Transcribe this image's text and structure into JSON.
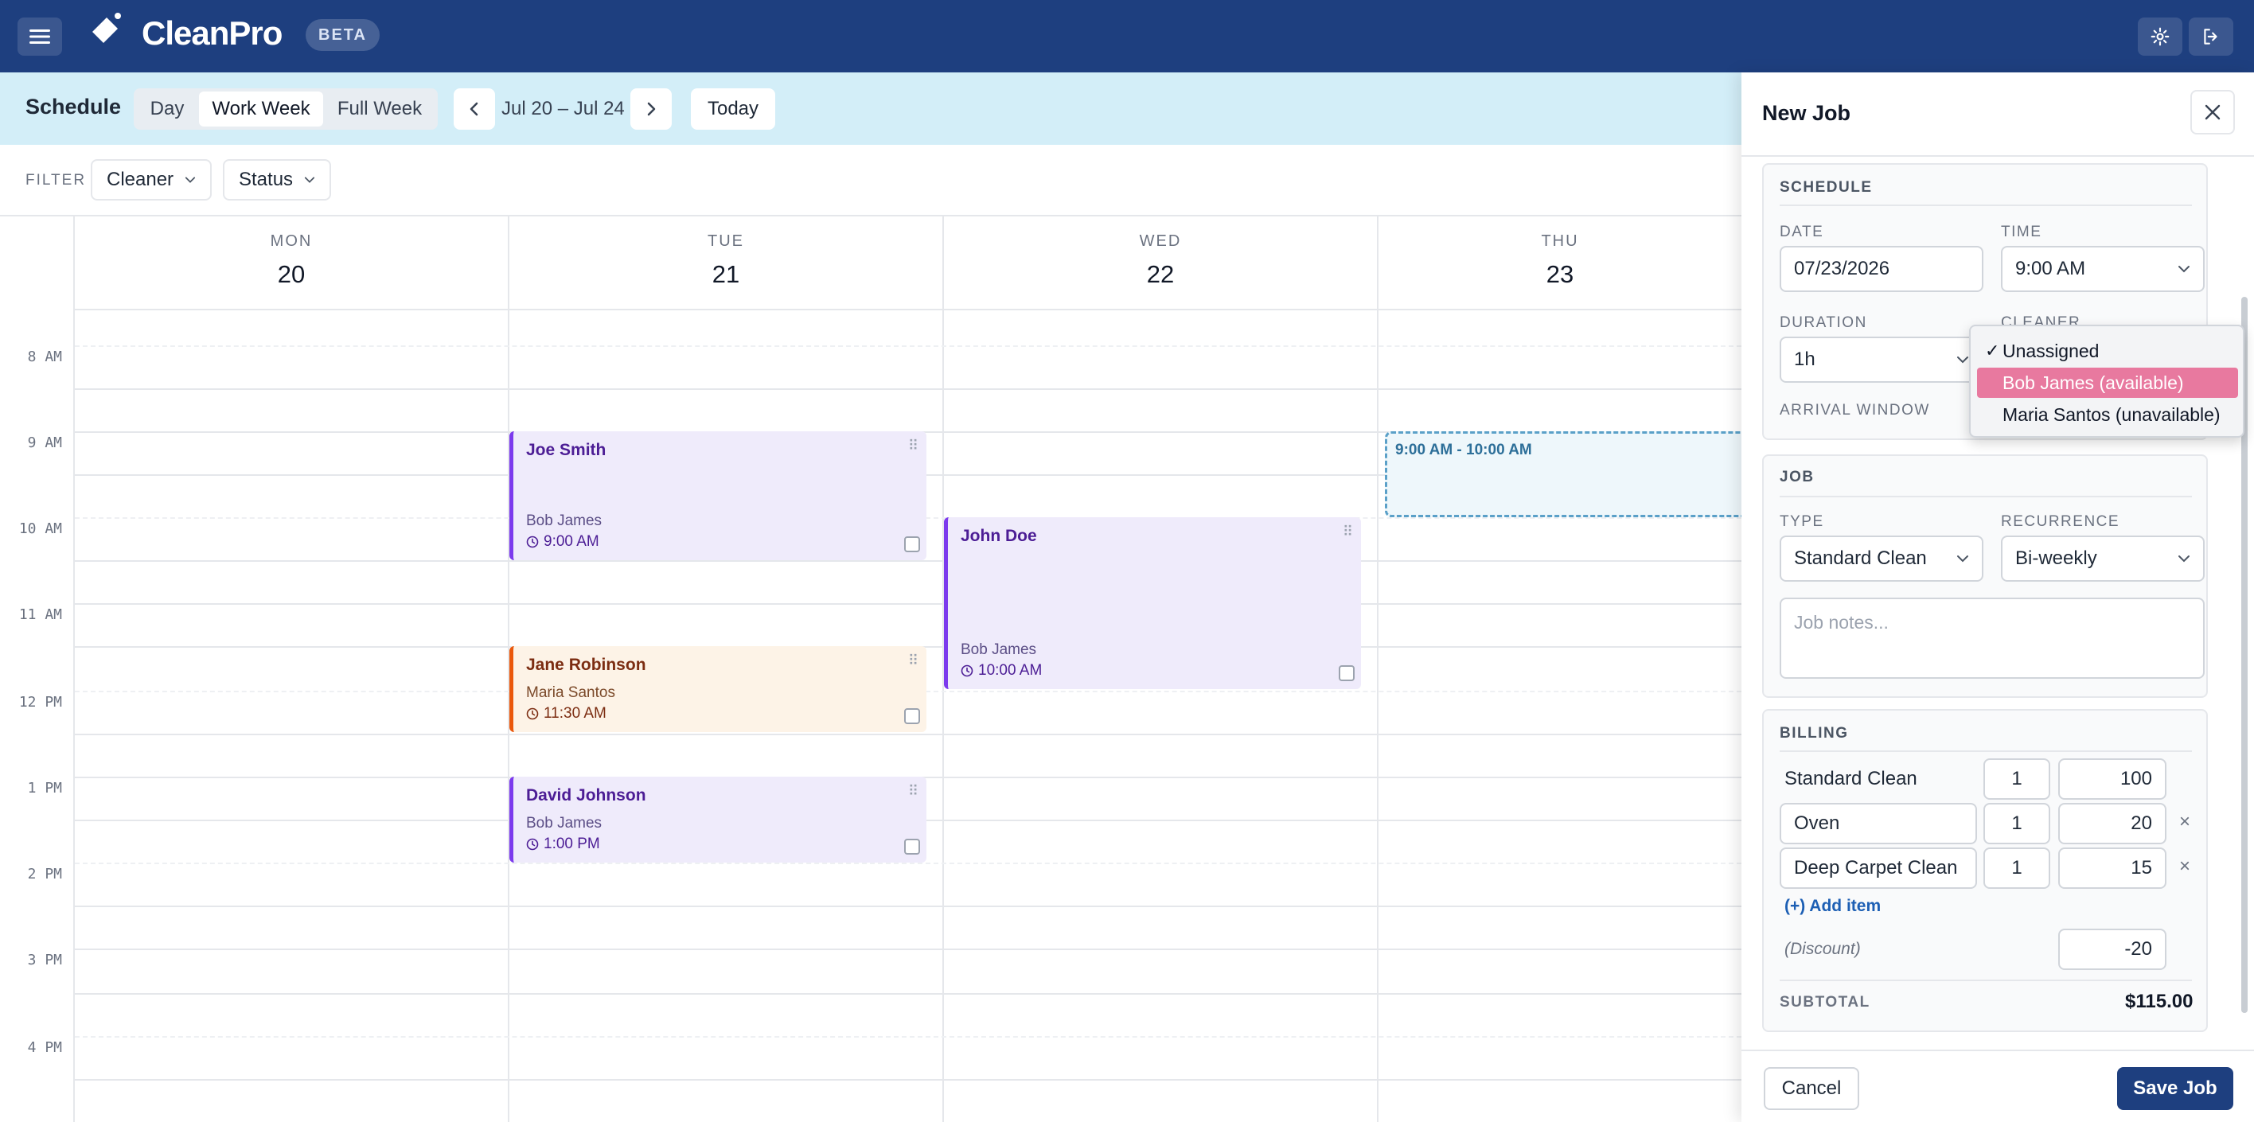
{
  "app": {
    "name": "CleanPro",
    "badge": "BETA"
  },
  "toolbar": {
    "title": "Schedule",
    "views": [
      "Day",
      "Work Week",
      "Full Week"
    ],
    "active_view": "Work Week",
    "range": "Jul 20 – Jul 24",
    "today": "Today"
  },
  "filters": {
    "label": "FILTER",
    "cleaner": "Cleaner",
    "status": "Status"
  },
  "calendar": {
    "days": [
      {
        "name": "MON",
        "num": "20"
      },
      {
        "name": "TUE",
        "num": "21"
      },
      {
        "name": "WED",
        "num": "22"
      },
      {
        "name": "THU",
        "num": "23"
      }
    ],
    "hours": [
      "8 AM",
      "9 AM",
      "10 AM",
      "11 AM",
      "12 PM",
      "1 PM",
      "2 PM",
      "3 PM",
      "4 PM"
    ],
    "events": [
      {
        "customer": "Joe Smith",
        "cleaner": "Bob James",
        "time": "9:00 AM",
        "day": "TUE",
        "start": "9:00 AM",
        "duration_hours": 1.5,
        "color": "purple"
      },
      {
        "customer": "John Doe",
        "cleaner": "Bob James",
        "time": "10:00 AM",
        "day": "WED",
        "start": "10:00 AM",
        "duration_hours": 2,
        "color": "purple"
      },
      {
        "customer": "Jane Robinson",
        "cleaner": "Maria Santos",
        "time": "11:30 AM",
        "day": "TUE",
        "start": "11:30 AM",
        "duration_hours": 1,
        "color": "orange"
      },
      {
        "customer": "David Johnson",
        "cleaner": "Bob James",
        "time": "1:00 PM",
        "day": "TUE",
        "start": "1:00 PM",
        "duration_hours": 1,
        "color": "purple"
      }
    ],
    "draft_slot": {
      "label": "9:00 AM - 10:00 AM",
      "day": "THU"
    }
  },
  "panel": {
    "title": "New Job",
    "schedule": {
      "title": "SCHEDULE",
      "date_label": "DATE",
      "date": "07/23/2026",
      "time_label": "TIME",
      "time": "9:00 AM",
      "duration_label": "DURATION",
      "duration": "1h",
      "cleaner_label": "CLEANER",
      "arrival_label": "ARRIVAL WINDOW"
    },
    "cleaner_options": [
      "Unassigned",
      "Bob James (available)",
      "Maria Santos (unavailable)"
    ],
    "cleaner_selected": "Unassigned",
    "cleaner_highlighted": "Bob James (available)",
    "job": {
      "title": "JOB",
      "type_label": "TYPE",
      "type": "Standard Clean",
      "recurrence_label": "RECURRENCE",
      "recurrence": "Bi-weekly",
      "notes_placeholder": "Job notes..."
    },
    "billing": {
      "title": "BILLING",
      "items": [
        {
          "name": "Standard Clean",
          "qty": "1",
          "price": "100",
          "removable": false
        },
        {
          "name": "Oven",
          "qty": "1",
          "price": "20",
          "removable": true
        },
        {
          "name": "Deep Carpet Clean",
          "qty": "1",
          "price": "15",
          "removable": true
        }
      ],
      "add_item": "(+) Add item",
      "discount_label": "(Discount)",
      "discount": "-20",
      "subtotal_label": "SUBTOTAL",
      "subtotal": "$115.00"
    },
    "cancel": "Cancel",
    "save": "Save Job"
  },
  "colors": {
    "topbar": "#1e3f7f",
    "accent_purple": "#7c3aed",
    "accent_orange": "#ea580c",
    "highlight": "#e8799f"
  }
}
